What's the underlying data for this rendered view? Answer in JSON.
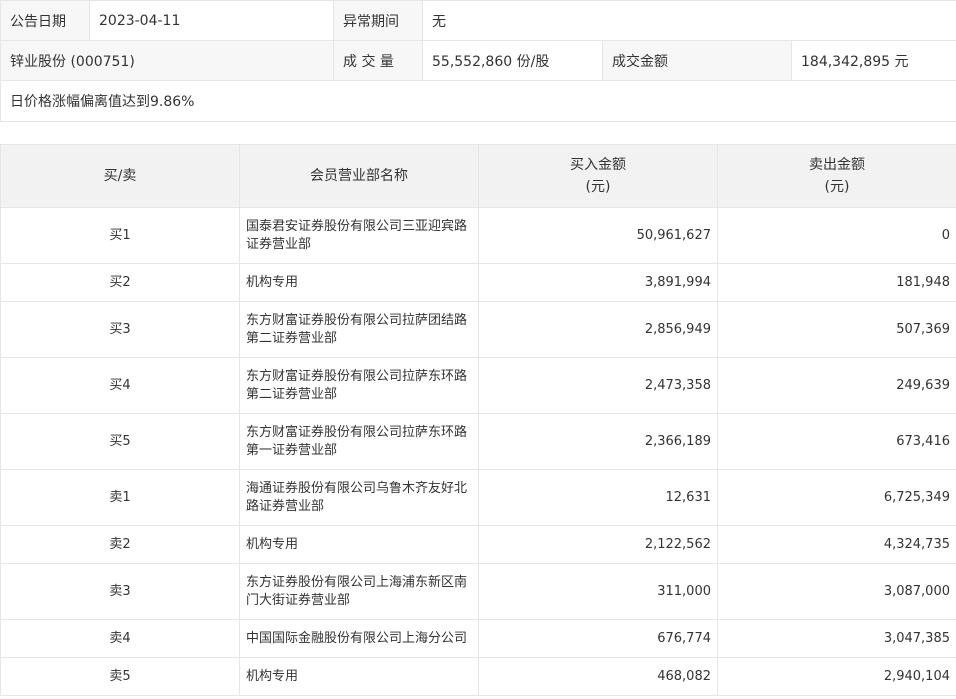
{
  "info": {
    "announce_date_label": "公告日期",
    "announce_date": "2023-04-11",
    "abnormal_period_label": "异常期间",
    "abnormal_period": "无",
    "stock": "锌业股份 (000751)",
    "volume_label": "成 交 量",
    "volume": "55,552,860 份/股",
    "turnover_label": "成交金额",
    "turnover": "184,342,895 元",
    "reason": "日价格涨幅偏离值达到9.86%"
  },
  "table": {
    "headers": {
      "side": "买/卖",
      "dept": "会员营业部名称",
      "buy_line1": "买入金额",
      "buy_line2": "(元)",
      "sell_line1": "卖出金额",
      "sell_line2": "(元)"
    },
    "rows": [
      {
        "side": "买1",
        "dept": "国泰君安证券股份有限公司三亚迎宾路证券营业部",
        "buy": "50,961,627",
        "sell": "0"
      },
      {
        "side": "买2",
        "dept": "机构专用",
        "buy": "3,891,994",
        "sell": "181,948"
      },
      {
        "side": "买3",
        "dept": "东方财富证券股份有限公司拉萨团结路第二证券营业部",
        "buy": "2,856,949",
        "sell": "507,369"
      },
      {
        "side": "买4",
        "dept": "东方财富证券股份有限公司拉萨东环路第二证券营业部",
        "buy": "2,473,358",
        "sell": "249,639"
      },
      {
        "side": "买5",
        "dept": "东方财富证券股份有限公司拉萨东环路第一证券营业部",
        "buy": "2,366,189",
        "sell": "673,416"
      },
      {
        "side": "卖1",
        "dept": "海通证券股份有限公司乌鲁木齐友好北路证券营业部",
        "buy": "12,631",
        "sell": "6,725,349"
      },
      {
        "side": "卖2",
        "dept": "机构专用",
        "buy": "2,122,562",
        "sell": "4,324,735"
      },
      {
        "side": "卖3",
        "dept": "东方证券股份有限公司上海浦东新区南门大街证券营业部",
        "buy": "311,000",
        "sell": "3,087,000"
      },
      {
        "side": "卖4",
        "dept": "中国国际金融股份有限公司上海分公司",
        "buy": "676,774",
        "sell": "3,047,385"
      },
      {
        "side": "卖5",
        "dept": "机构专用",
        "buy": "468,082",
        "sell": "2,940,104"
      }
    ]
  }
}
